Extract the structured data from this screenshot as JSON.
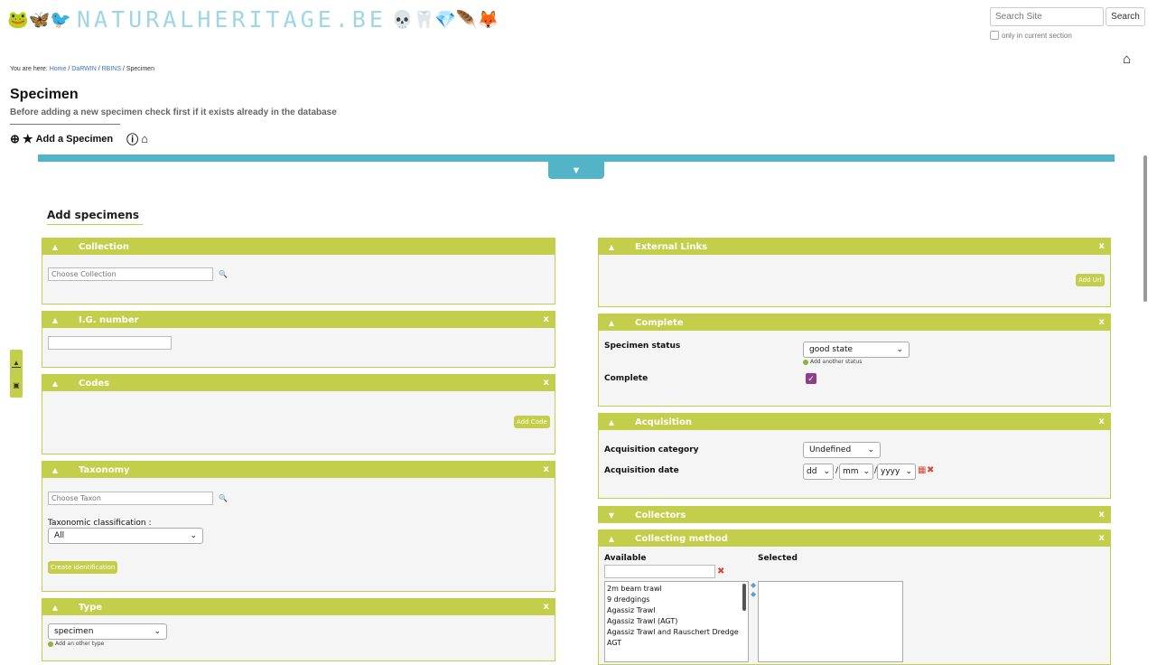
{
  "header": {
    "logo_icons_left": "🐸🦋🐦",
    "logo_text": "NATURALHERITAGE.BE",
    "logo_icons_right": "💀🦷💎🪶🦊",
    "search_placeholder": "Search Site",
    "search_button": "Search",
    "only_current_section": "only in current section"
  },
  "breadcrumb": {
    "prefix": "You are here:",
    "items": [
      "Home",
      "DaRWIN",
      "RBINS",
      "Specimen"
    ]
  },
  "page": {
    "title": "Specimen",
    "subtitle": "Before adding a new specimen check first if it exists already in the database",
    "add_label": "Add a Specimen",
    "section_heading": "Add specimens"
  },
  "left_panels": {
    "collection": {
      "title": "Collection",
      "input_placeholder": "Choose Collection"
    },
    "ig": {
      "title": "I.G. number",
      "close": "x"
    },
    "codes": {
      "title": "Codes",
      "close": "x",
      "button": "Add Code"
    },
    "taxonomy": {
      "title": "Taxonomy",
      "close": "x",
      "input_placeholder": "Choose Taxon",
      "classification_label": "Taxonomic classification :",
      "classification_value": "All",
      "button": "Create identification"
    },
    "type": {
      "title": "Type",
      "close": "x",
      "value": "specimen",
      "add_other": "Add an other type"
    }
  },
  "right_panels": {
    "external_links": {
      "title": "External Links",
      "close": "x",
      "button": "Add Url"
    },
    "complete": {
      "title": "Complete",
      "close": "x",
      "status_label": "Specimen status",
      "status_value": "good state",
      "add_status": "Add another status",
      "complete_label": "Complete",
      "complete_checked": true
    },
    "acquisition": {
      "title": "Acquisition",
      "close": "x",
      "category_label": "Acquisition category",
      "category_value": "Undefined",
      "date_label": "Acquisition date",
      "dd": "dd",
      "mm": "mm",
      "yyyy": "yyyy"
    },
    "collectors": {
      "title": "Collectors",
      "close": "x"
    },
    "collecting_method": {
      "title": "Collecting method",
      "close": "x",
      "available_label": "Available",
      "selected_label": "Selected",
      "options": [
        "2m beam trawl",
        "9 dredgings",
        "Agassiz Trawl",
        "Agassiz Trawl (AGT)",
        "Agassiz Trawl and Rauschert Dredge",
        "AGT"
      ]
    }
  },
  "colors": {
    "accent": "#c3cf4a",
    "bar": "#53b3c7",
    "checkbox": "#8d3f8a"
  }
}
